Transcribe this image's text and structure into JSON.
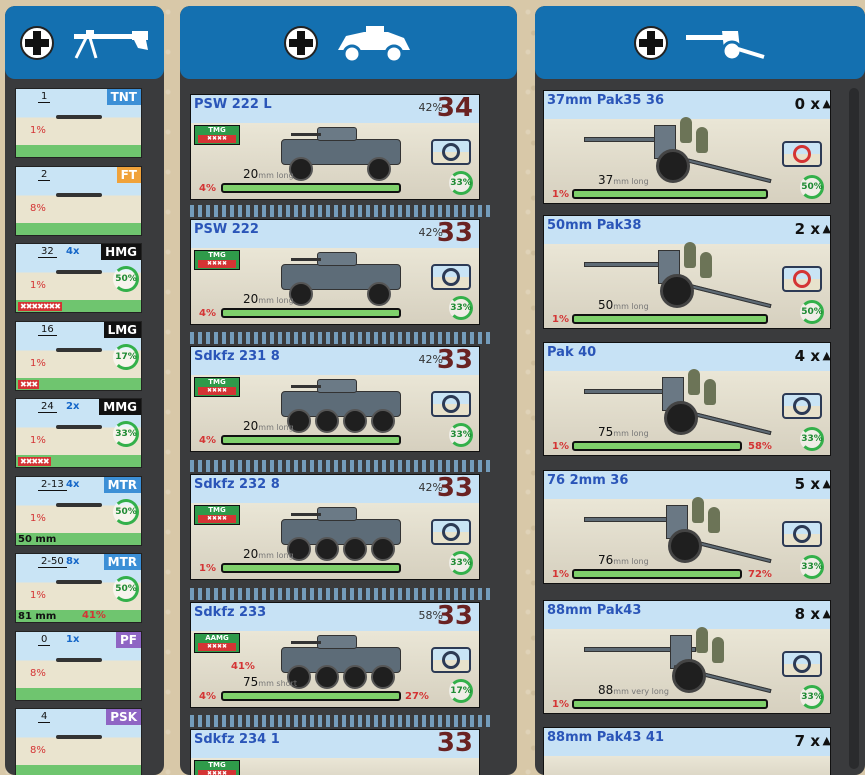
{
  "colors": {
    "header_blue": "#1470b0",
    "panel_dark": "#3a3b3d",
    "name_blue": "#2a55b8",
    "cost_red": "#6a2222",
    "tmg_green": "#2f9b4a",
    "accuracy_green": "#33b04a",
    "chance_red": "#d43434"
  },
  "infantry_panel": {
    "header_icon": "machine-gun-icon",
    "cards": [
      {
        "tag": "TNT",
        "tag_color": "#3c8fd6",
        "range": "1",
        "mult": "",
        "pct": "1%",
        "sub": "",
        "skulls": "",
        "ring": "",
        "pct2": "",
        "icon": "satchel-charge-icon"
      },
      {
        "tag": "FT",
        "tag_color": "#f0a23a",
        "range": "2",
        "mult": "",
        "pct": "8%",
        "sub": "",
        "skulls": "",
        "ring": "",
        "pct2": "",
        "icon": "flamethrower-icon"
      },
      {
        "tag": "HMG",
        "tag_color": "#111111",
        "range": "32",
        "mult": "4x",
        "pct": "1%",
        "sub": "",
        "skulls": "✖✖✖✖✖✖✖",
        "ring": "50%",
        "pct2": "",
        "icon": "heavy-machine-gun-icon"
      },
      {
        "tag": "LMG",
        "tag_color": "#111111",
        "range": "16",
        "mult": "",
        "pct": "1%",
        "sub": "",
        "skulls": "✖✖✖",
        "ring": "17%",
        "pct2": "",
        "icon": "light-machine-gun-icon"
      },
      {
        "tag": "MMG",
        "tag_color": "#111111",
        "range": "24",
        "mult": "2x",
        "pct": "1%",
        "sub": "",
        "skulls": "✖✖✖✖✖",
        "ring": "33%",
        "pct2": "",
        "icon": "medium-machine-gun-icon"
      },
      {
        "tag": "MTR",
        "tag_color": "#3c8fd6",
        "range": "2-13",
        "mult": "4x",
        "pct": "1%",
        "sub": "50 mm",
        "skulls": "",
        "ring": "50%",
        "pct2": "",
        "icon": "mortar-icon"
      },
      {
        "tag": "MTR",
        "tag_color": "#3c8fd6",
        "range": "2-50",
        "mult": "8x",
        "pct": "1%",
        "sub": "81 mm",
        "skulls": "",
        "ring": "50%",
        "pct2": "41%",
        "icon": "mortar-icon"
      },
      {
        "tag": "PF",
        "tag_color": "#8f65c4",
        "range": "0",
        "mult": "1x",
        "pct": "8%",
        "sub": "",
        "skulls": "",
        "ring": "",
        "pct2": "",
        "icon": "panzerfaust-icon"
      },
      {
        "tag": "PSK",
        "tag_color": "#8f65c4",
        "range": "4",
        "mult": "",
        "pct": "8%",
        "sub": "",
        "skulls": "",
        "ring": "",
        "pct2": "",
        "icon": "panzerschreck-icon"
      }
    ]
  },
  "vehicle_panel": {
    "header_icon": "armored-car-icon",
    "cards": [
      {
        "name": "PSW 222 L",
        "cost": "34",
        "armor": "42%",
        "tmg_label": "TMG",
        "left_pct": "4%",
        "cal_num": "20",
        "cal_unit": "mm long",
        "ring": "33%",
        "extra_pct": "",
        "side_pct": ""
      },
      {
        "name": "PSW 222",
        "cost": "33",
        "armor": "42%",
        "tmg_label": "TMG",
        "left_pct": "4%",
        "cal_num": "20",
        "cal_unit": "mm long",
        "ring": "33%",
        "extra_pct": "",
        "side_pct": ""
      },
      {
        "name": "Sdkfz 231 8",
        "cost": "33",
        "armor": "42%",
        "tmg_label": "TMG",
        "left_pct": "4%",
        "cal_num": "20",
        "cal_unit": "mm long",
        "ring": "33%",
        "extra_pct": "",
        "side_pct": ""
      },
      {
        "name": "Sdkfz 232 8",
        "cost": "33",
        "armor": "42%",
        "tmg_label": "TMG",
        "left_pct": "1%",
        "cal_num": "20",
        "cal_unit": "mm long",
        "ring": "33%",
        "extra_pct": "",
        "side_pct": ""
      },
      {
        "name": "Sdkfz 233",
        "cost": "33",
        "armor": "58%",
        "tmg_label": "AAMG",
        "left_pct": "4%",
        "cal_num": "75",
        "cal_unit": "mm short",
        "ring": "17%",
        "extra_pct": "27%",
        "side_pct": "41%"
      },
      {
        "name": "Sdkfz 234 1",
        "cost": "33",
        "armor": "",
        "tmg_label": "TMG",
        "left_pct": "",
        "cal_num": "",
        "cal_unit": "",
        "ring": "",
        "extra_pct": "",
        "side_pct": ""
      }
    ]
  },
  "at_panel": {
    "header_icon": "anti-tank-gun-icon",
    "cards": [
      {
        "name": "37mm Pak35 36",
        "qty": "0 x",
        "left_pct": "1%",
        "cal_num": "37",
        "cal_unit": "mm long",
        "ring": "50%",
        "extra_pct": ""
      },
      {
        "name": "50mm Pak38",
        "qty": "2 x",
        "left_pct": "1%",
        "cal_num": "50",
        "cal_unit": "mm long",
        "ring": "50%",
        "extra_pct": ""
      },
      {
        "name": "Pak 40",
        "qty": "4 x",
        "left_pct": "1%",
        "cal_num": "75",
        "cal_unit": "mm long",
        "ring": "33%",
        "extra_pct": "58%"
      },
      {
        "name": "76 2mm 36",
        "qty": "5 x",
        "left_pct": "1%",
        "cal_num": "76",
        "cal_unit": "mm long",
        "ring": "33%",
        "extra_pct": "72%"
      },
      {
        "name": "88mm Pak43",
        "qty": "8 x",
        "left_pct": "1%",
        "cal_num": "88",
        "cal_unit": "mm very long",
        "ring": "33%",
        "extra_pct": ""
      },
      {
        "name": "88mm Pak43 41",
        "qty": "7 x",
        "left_pct": "",
        "cal_num": "",
        "cal_unit": "",
        "ring": "",
        "extra_pct": ""
      }
    ]
  }
}
